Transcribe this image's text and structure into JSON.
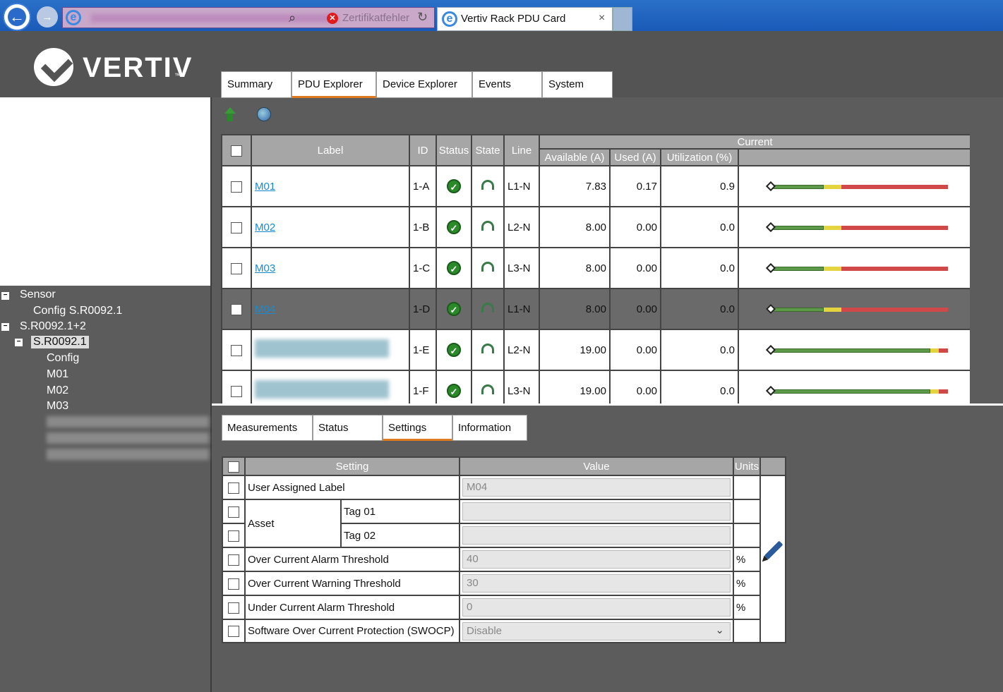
{
  "browser": {
    "error_text": "Zertifikatfehler",
    "tab_title": "Vertiv Rack PDU Card",
    "tab_close": "×"
  },
  "brand": {
    "name": "VERTIV",
    "tm": "™"
  },
  "main_tabs": [
    "Summary",
    "PDU Explorer",
    "Device Explorer",
    "Events",
    "System"
  ],
  "main_tab_active": "PDU Explorer",
  "tree": {
    "sensor": "Sensor",
    "config_sensor": "Config S.R0092.1",
    "group": "S.R0092.1+2",
    "selected": "S.R0092.1",
    "config": "Config",
    "m01": "M01",
    "m02": "M02",
    "m03": "M03"
  },
  "outlet_table": {
    "headers": {
      "label": "Label",
      "id": "ID",
      "status": "Status",
      "state": "State",
      "line": "Line",
      "current": "Current",
      "available": "Available (A)",
      "used": "Used (A)",
      "utilization": "Utilization (%)"
    },
    "rows": [
      {
        "label": "M01",
        "id": "1-A",
        "line": "L1-N",
        "available": "7.83",
        "used": "0.17",
        "util": "0.9",
        "bar": [
          0.3,
          0.1,
          0.6
        ],
        "selected": false
      },
      {
        "label": "M02",
        "id": "1-B",
        "line": "L2-N",
        "available": "8.00",
        "used": "0.00",
        "util": "0.0",
        "bar": [
          0.3,
          0.1,
          0.6
        ],
        "selected": false
      },
      {
        "label": "M03",
        "id": "1-C",
        "line": "L3-N",
        "available": "8.00",
        "used": "0.00",
        "util": "0.0",
        "bar": [
          0.3,
          0.1,
          0.6
        ],
        "selected": false
      },
      {
        "label": "M04",
        "id": "1-D",
        "line": "L1-N",
        "available": "8.00",
        "used": "0.00",
        "util": "0.0",
        "bar": [
          0.3,
          0.1,
          0.6
        ],
        "selected": true
      },
      {
        "label": "",
        "id": "1-E",
        "line": "L2-N",
        "available": "19.00",
        "used": "0.00",
        "util": "0.0",
        "bar": [
          0.9,
          0.05,
          0.05
        ],
        "selected": false
      },
      {
        "label": "",
        "id": "1-F",
        "line": "L3-N",
        "available": "19.00",
        "used": "0.00",
        "util": "0.0",
        "bar": [
          0.9,
          0.05,
          0.05
        ],
        "selected": false
      }
    ]
  },
  "detail_tabs": [
    "Measurements",
    "Status",
    "Settings",
    "Information"
  ],
  "detail_tab_active": "Settings",
  "settings": {
    "headers": {
      "setting": "Setting",
      "value": "Value",
      "units": "Units"
    },
    "rows": {
      "label": {
        "name": "User Assigned Label",
        "value": "M04",
        "unit": ""
      },
      "asset": "Asset",
      "tag1": {
        "name": "Tag 01",
        "value": "",
        "unit": ""
      },
      "tag2": {
        "name": "Tag 02",
        "value": "",
        "unit": ""
      },
      "oc_alarm": {
        "name": "Over Current Alarm Threshold",
        "value": "40",
        "unit": "%"
      },
      "oc_warn": {
        "name": "Over Current Warning Threshold",
        "value": "30",
        "unit": "%"
      },
      "uc_alarm": {
        "name": "Under Current Alarm Threshold",
        "value": "0",
        "unit": "%"
      },
      "swocp": {
        "name": "Software Over Current Protection (SWOCP)",
        "value": "Disable",
        "unit": ""
      }
    }
  }
}
